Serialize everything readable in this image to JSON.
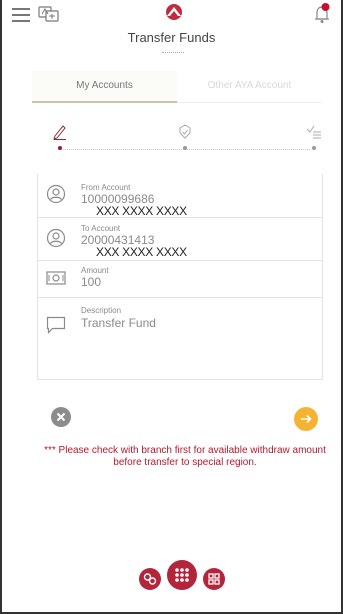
{
  "header": {
    "title": "Transfer Funds",
    "menu_icon": "hamburger-menu-icon",
    "language_icon": "language-icon",
    "logo_icon": "bank-logo-icon",
    "notification_icon": "notification-bell-icon"
  },
  "tabs": [
    {
      "label": "My Accounts",
      "active": true
    },
    {
      "label": "Other AYA Account",
      "active": false
    }
  ],
  "steps": [
    {
      "icon": "pencil-icon",
      "active": true
    },
    {
      "icon": "check-shield-icon",
      "active": false
    },
    {
      "icon": "confirm-list-icon",
      "active": false
    }
  ],
  "form": {
    "from_account": {
      "label": "From Account",
      "value": "10000099686",
      "holder": "XXX XXXX XXXX",
      "icon": "account-user-icon"
    },
    "to_account": {
      "label": "To Account",
      "value": "20000431413",
      "holder": "XXX XXXX XXXX",
      "icon": "account-user-icon"
    },
    "amount": {
      "label": "Amount",
      "value": "100",
      "icon": "cash-icon"
    },
    "description": {
      "label": "Description",
      "value": "Transfer Fund",
      "icon": "comment-icon"
    }
  },
  "actions": {
    "cancel_icon": "close-icon",
    "next_icon": "arrow-right-icon"
  },
  "warning_text": "*** Please check with branch first for available withdraw amount before transfer to special region.",
  "bottom_nav": [
    {
      "icon": "apps-swap-icon"
    },
    {
      "icon": "grid-menu-icon"
    },
    {
      "icon": "qr-code-icon"
    }
  ],
  "colors": {
    "brand": "#b2253a",
    "warning": "#b5182d",
    "next_button": "#f6b333",
    "cancel_button": "#8c8c8c"
  }
}
